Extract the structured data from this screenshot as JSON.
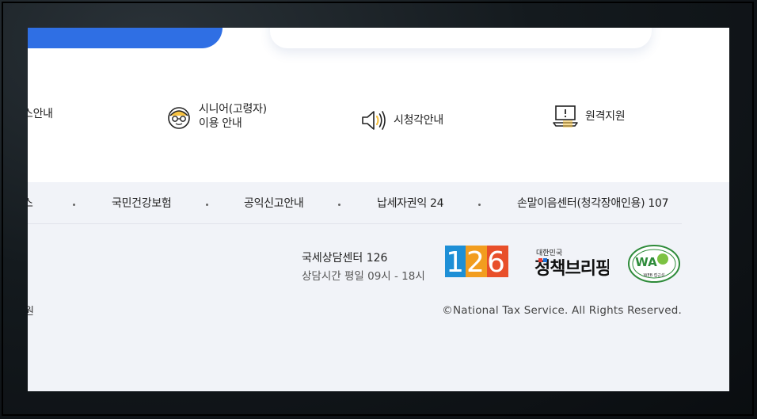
{
  "quick_menu": [
    {
      "label_line1": "스안내",
      "label_line2": "",
      "icon": "service-guide-icon"
    },
    {
      "label_line1": "시니어(고령자)",
      "label_line2": "이용 안내",
      "icon": "senior-face-icon"
    },
    {
      "label_line1": "시청각안내",
      "label_line2": "",
      "icon": "speaker-icon"
    },
    {
      "label_line1": "원격지원",
      "label_line2": "",
      "icon": "remote-support-laptop-icon"
    }
  ],
  "footer_links": [
    {
      "label": "스"
    },
    {
      "label": "국민건강보험"
    },
    {
      "label": "공익신고안내"
    },
    {
      "label": "납세자권익 24"
    },
    {
      "label": "손말이음센터(청각장애인용) 107"
    }
  ],
  "contact": {
    "name": "국세상담센터 126",
    "hours": "상담시간 평일 09시 - 18시"
  },
  "badges": {
    "number_126": "126",
    "policy_small": "대한민국",
    "policy_big": "정책브리핑",
    "wa_text": "WA",
    "wa_sub": "WEB 접근성"
  },
  "footer_misc": {
    "left_fragment": "원",
    "copyright": "©National Tax Service. All Rights Reserved."
  },
  "colors": {
    "accent_blue": "#2f6fe4",
    "footer_bg": "#f1f3f8",
    "icon_yellow": "#f6c243"
  }
}
